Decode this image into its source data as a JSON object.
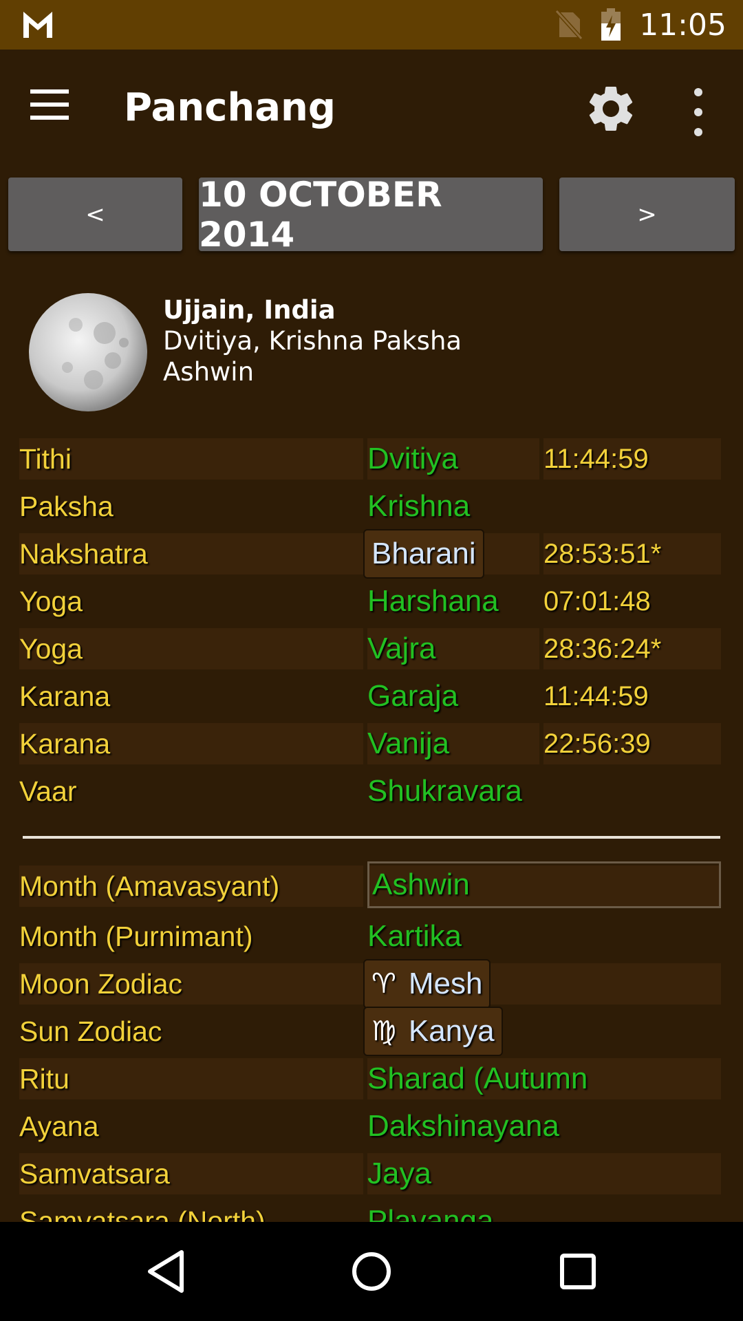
{
  "status_bar": {
    "time": "11:05",
    "notification_icon": "gmail-icon",
    "sim_icon": "no-sim-icon",
    "battery_icon": "battery-charging-icon"
  },
  "toolbar": {
    "title": "Panchang",
    "menu_icon": "hamburger-icon",
    "settings_icon": "gear-icon",
    "overflow_icon": "more-vert-icon"
  },
  "date_nav": {
    "prev_label": "<",
    "date": "10 OCTOBER 2014",
    "next_label": ">"
  },
  "location": {
    "city": "Ujjain, India",
    "tithi_paksha": "Dvitiya, Krishna Paksha",
    "month": "Ashwin"
  },
  "panchang_rows": [
    {
      "label": "Tithi",
      "value": "Dvitiya",
      "time": "11:44:59"
    },
    {
      "label": "Paksha",
      "value": "Krishna",
      "time": ""
    },
    {
      "label": "Nakshatra",
      "value": "Bharani",
      "time": "28:53:51*"
    },
    {
      "label": "Yoga",
      "value": "Harshana",
      "time": "07:01:48"
    },
    {
      "label": "Yoga",
      "value": "Vajra",
      "time": "28:36:24*"
    },
    {
      "label": "Karana",
      "value": "Garaja",
      "time": "11:44:59"
    },
    {
      "label": "Karana",
      "value": "Vanija",
      "time": "22:56:39"
    },
    {
      "label": "Vaar",
      "value": "Shukravara",
      "time": ""
    }
  ],
  "details_rows": [
    {
      "label": "Month (Amavasyant)",
      "value": "Ashwin"
    },
    {
      "label": "Month (Purnimant)",
      "value": "Kartika"
    },
    {
      "label": "Moon Zodiac",
      "value": "Mesh",
      "symbol": "♈"
    },
    {
      "label": "Sun Zodiac",
      "value": "Kanya",
      "symbol": "♍"
    },
    {
      "label": "Ritu",
      "value": "Sharad (Autumn"
    },
    {
      "label": "Ayana",
      "value": "Dakshinayana"
    },
    {
      "label": "Samvatsara",
      "value": "Jaya"
    },
    {
      "label": "Samvatsara (North)",
      "value": "Plavanga"
    }
  ],
  "colors": {
    "status_bar": "#613f02",
    "background": "#2e1c06",
    "label": "#f2d13a",
    "value": "#22c022",
    "chip_text": "#d5e6ff",
    "button": "#5f5d5d"
  }
}
